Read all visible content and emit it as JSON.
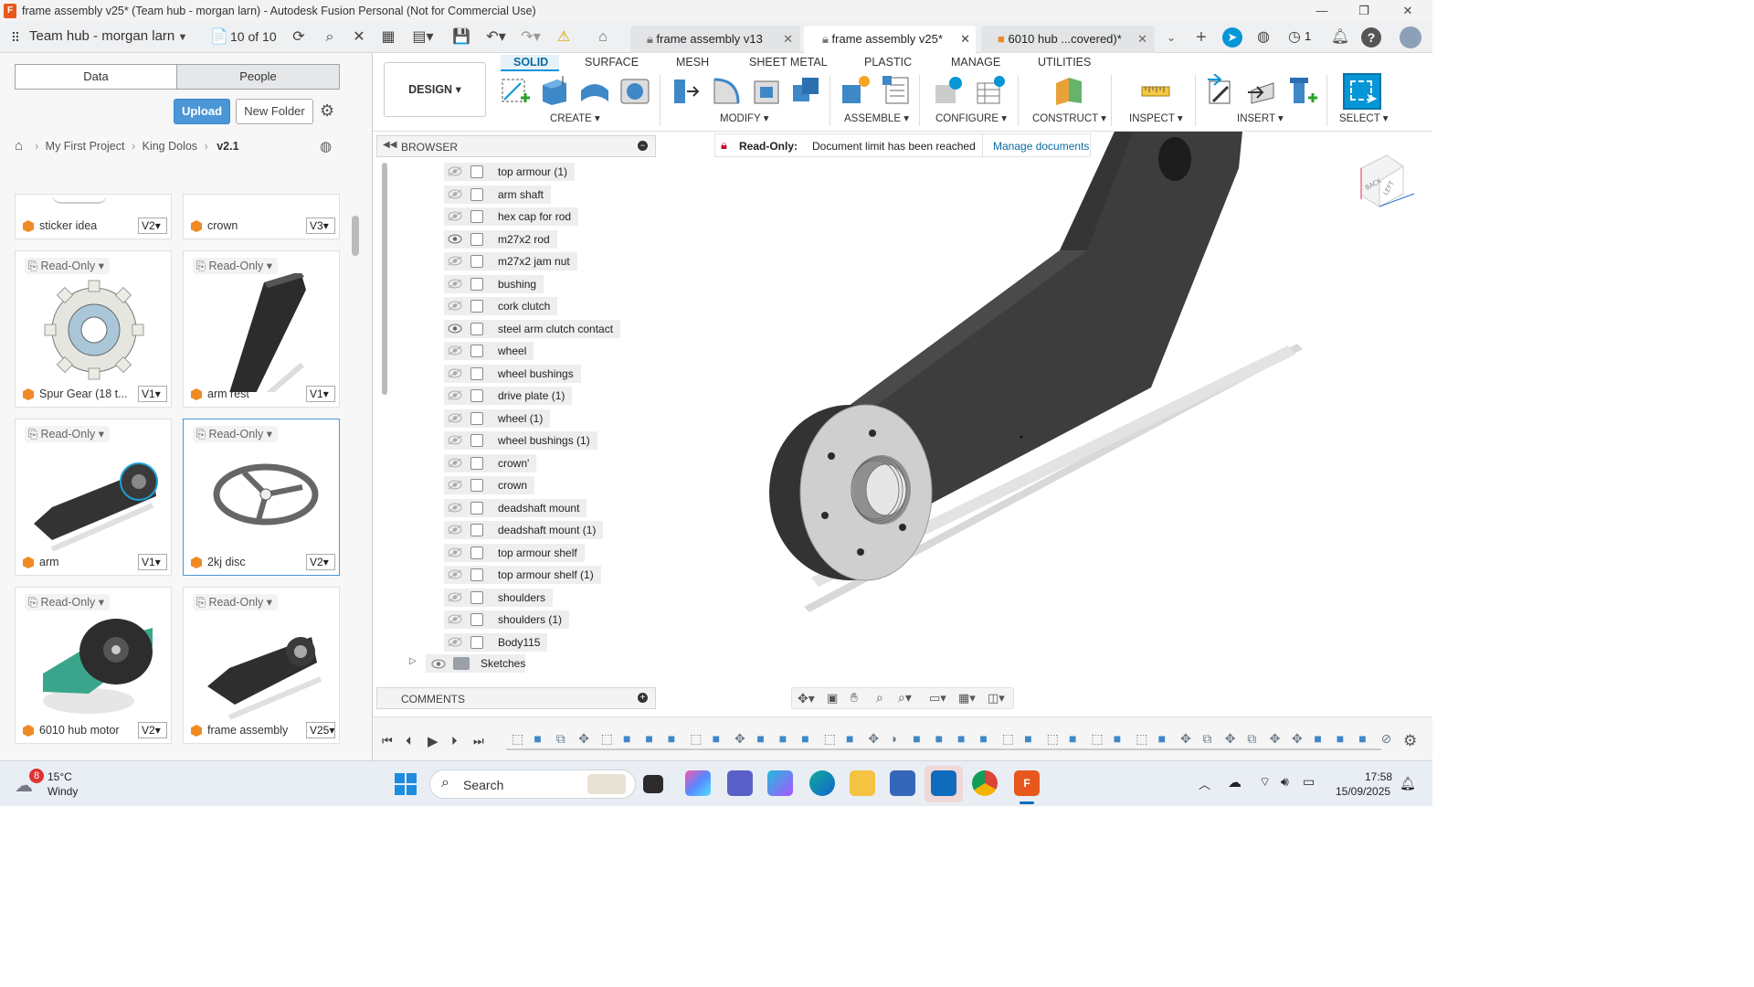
{
  "window": {
    "title": "frame assembly v25* (Team hub - morgan larn) - Autodesk Fusion Personal (Not for Commercial Use)",
    "app_icon_letter": "F"
  },
  "appbar": {
    "hub_name": "Team hub - morgan larn",
    "job_count": "10 of 10",
    "notification_count": "1"
  },
  "tabs": [
    {
      "label": "frame assembly v13",
      "active": false
    },
    {
      "label": "frame assembly v25*",
      "active": true
    },
    {
      "label": "6010 hub ...covered)*",
      "active": false
    }
  ],
  "left_panel": {
    "segment_data": "Data",
    "segment_people": "People",
    "upload_label": "Upload",
    "new_folder_label": "New Folder",
    "breadcrumb": [
      "My First Project",
      "King Dolos",
      "v2.1"
    ],
    "read_only_label": "Read-Only",
    "cards": [
      {
        "name": "sticker idea",
        "version": "V2"
      },
      {
        "name": "crown",
        "version": "V3"
      },
      {
        "name": "Spur Gear (18 t...",
        "version": "V1"
      },
      {
        "name": "arm rest",
        "version": "V1"
      },
      {
        "name": "arm",
        "version": "V1"
      },
      {
        "name": "2kj disc",
        "version": "V2"
      },
      {
        "name": "6010 hub motor",
        "version": "V2"
      },
      {
        "name": "frame assembly",
        "version": "V25"
      }
    ]
  },
  "ribbon": {
    "workspace": "DESIGN",
    "tabs": [
      "SOLID",
      "SURFACE",
      "MESH",
      "SHEET METAL",
      "PLASTIC",
      "MANAGE",
      "UTILITIES"
    ],
    "groups": [
      "CREATE",
      "MODIFY",
      "ASSEMBLE",
      "CONFIGURE",
      "CONSTRUCT",
      "INSPECT",
      "INSERT",
      "SELECT"
    ]
  },
  "browser": {
    "title": "BROWSER",
    "items": [
      {
        "label": "top armour (1)",
        "visible": false
      },
      {
        "label": "arm shaft",
        "visible": false
      },
      {
        "label": "hex cap for rod",
        "visible": false
      },
      {
        "label": "m27x2 rod",
        "visible": true
      },
      {
        "label": "m27x2 jam nut",
        "visible": false
      },
      {
        "label": "bushing",
        "visible": false
      },
      {
        "label": "cork clutch",
        "visible": false
      },
      {
        "label": "steel arm clutch contact",
        "visible": true
      },
      {
        "label": "wheel",
        "visible": false
      },
      {
        "label": "wheel bushings",
        "visible": false
      },
      {
        "label": "drive plate (1)",
        "visible": false
      },
      {
        "label": "wheel (1)",
        "visible": false
      },
      {
        "label": "wheel bushings (1)",
        "visible": false
      },
      {
        "label": "crown'",
        "visible": false
      },
      {
        "label": "crown",
        "visible": false
      },
      {
        "label": "deadshaft mount",
        "visible": false
      },
      {
        "label": "deadshaft mount (1)",
        "visible": false
      },
      {
        "label": "top armour shelf",
        "visible": false
      },
      {
        "label": "top armour shelf (1)",
        "visible": false
      },
      {
        "label": "shoulders",
        "visible": false
      },
      {
        "label": "shoulders (1)",
        "visible": false
      },
      {
        "label": "Body115",
        "visible": false
      }
    ],
    "sketches_label": "Sketches",
    "comments_label": "COMMENTS"
  },
  "banner": {
    "label": "Read-Only:",
    "message": "Document limit has been reached",
    "link": "Manage documents"
  },
  "viewcube": {
    "back": "BACK",
    "left": "LEFT"
  },
  "taskbar": {
    "weather_temp": "15°C",
    "weather_desc": "Windy",
    "weather_badge": "8",
    "search_label": "Search",
    "time": "17:58",
    "date": "15/09/2025"
  },
  "colors": {
    "accent": "#0696d7",
    "brand_orange": "#f08a24",
    "model_dark": "#3d3d3d"
  }
}
